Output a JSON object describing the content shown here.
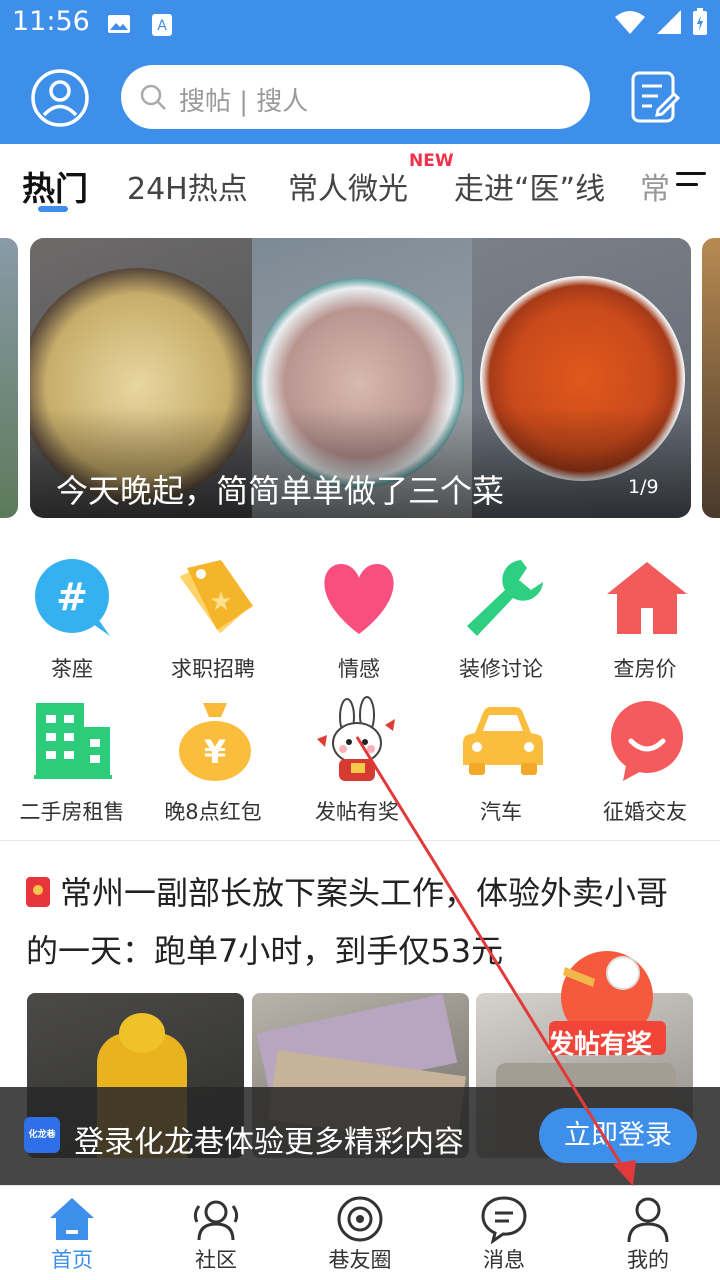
{
  "status_bar": {
    "time": "11:56"
  },
  "search": {
    "placeholder": "搜帖 | 搜人"
  },
  "tabs": [
    {
      "label": "热门",
      "active": true
    },
    {
      "label": "24H热点"
    },
    {
      "label": "常人微光",
      "badge": "NEW"
    },
    {
      "label": "走进“医”线"
    },
    {
      "label": "常"
    }
  ],
  "banner": {
    "caption": "今天晚起，简简单单做了三个菜",
    "counter": "1/9"
  },
  "grid": [
    {
      "label": "茶座",
      "icon": "hashtag-bubble-icon"
    },
    {
      "label": "求职招聘",
      "icon": "tag-icon"
    },
    {
      "label": "情感",
      "icon": "heart-icon"
    },
    {
      "label": "装修讨论",
      "icon": "wrench-icon"
    },
    {
      "label": "查房价",
      "icon": "house-icon"
    },
    {
      "label": "二手房租售",
      "icon": "building-icon"
    },
    {
      "label": "晚8点红包",
      "icon": "money-bag-icon"
    },
    {
      "label": "发帖有奖",
      "icon": "rabbit-mascot-icon"
    },
    {
      "label": "汽车",
      "icon": "car-icon"
    },
    {
      "label": "征婚交友",
      "icon": "smile-bubble-icon"
    }
  ],
  "article": {
    "title": "常州一副部长放下案头工作，体验外卖小哥的一天：跑单7小时，到手仅53元"
  },
  "promo": {
    "text": "发帖有奖"
  },
  "login_bar": {
    "logo_text": "化龙巷",
    "text": "登录化龙巷体验更多精彩内容",
    "button": "立即登录"
  },
  "bottom_nav": [
    {
      "label": "首页",
      "icon": "home-icon",
      "active": true
    },
    {
      "label": "社区",
      "icon": "community-icon"
    },
    {
      "label": "巷友圈",
      "icon": "circle-icon"
    },
    {
      "label": "消息",
      "icon": "message-icon"
    },
    {
      "label": "我的",
      "icon": "profile-icon"
    }
  ],
  "colors": {
    "primary": "#3d8fea",
    "accent_red": "#f0334a"
  }
}
